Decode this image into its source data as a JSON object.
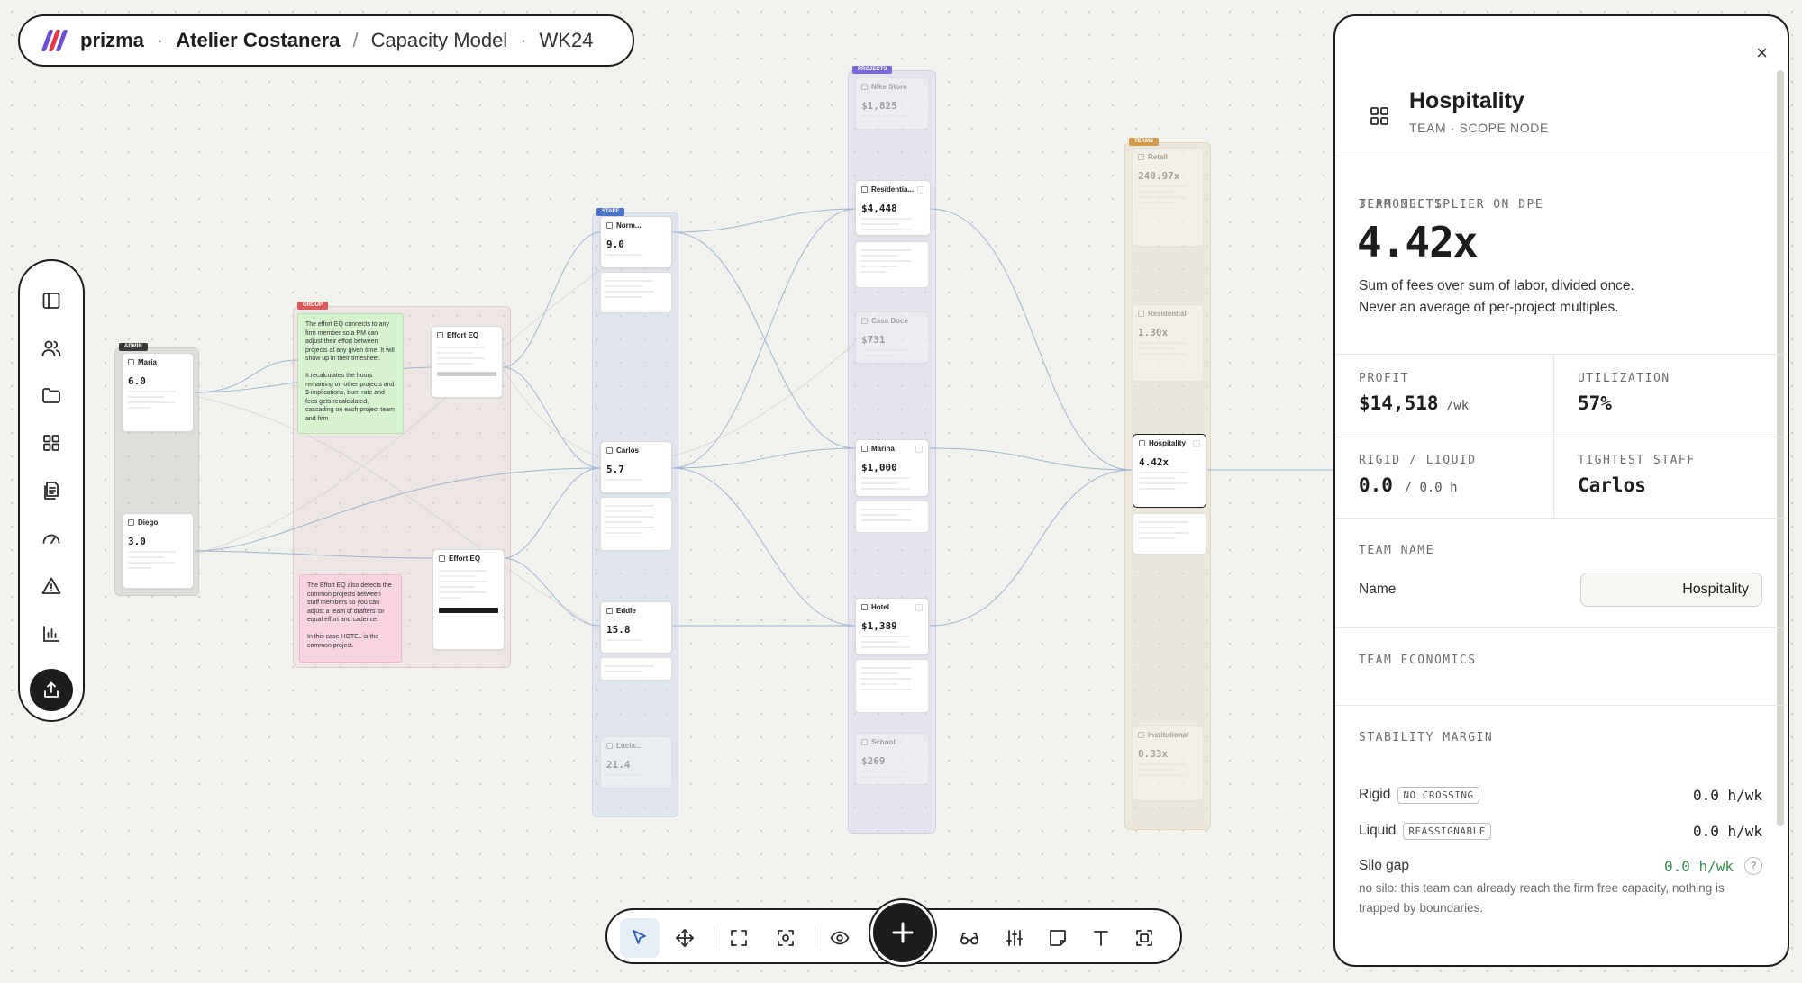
{
  "header": {
    "brand": "prizma",
    "separator_dot": "·",
    "organization": "Atelier Costanera",
    "separator_slash": "/",
    "model": "Capacity Model",
    "week": "WK24",
    "logo_colors": [
      "#6a4fd0",
      "#e6394a",
      "#6a4fd0"
    ]
  },
  "rail": {
    "items": [
      "sidebar-icon",
      "people-icon",
      "folder-icon",
      "grid-icon",
      "report-icon",
      "gauge-icon",
      "alert-icon",
      "bar-chart-icon"
    ],
    "export": "export-icon"
  },
  "canvas": {
    "lanes": {
      "admin": "ADMIN",
      "group": "GROUP",
      "staff": "STAFF",
      "projects": "PROJECTS",
      "teams": "TEAMS"
    },
    "lane_colors": {
      "admin": "#3a3a38",
      "group": "#d85a58",
      "staff": "#4a74c9",
      "projects": "#7c6ad6",
      "teams": "#d59a4a"
    },
    "admin": [
      {
        "name": "Maria",
        "value": "6.0"
      },
      {
        "name": "Diego",
        "value": "3.0"
      }
    ],
    "effort_eq_top": {
      "title": "Effort EQ"
    },
    "effort_eq_bottom": {
      "title": "Effort EQ"
    },
    "note_green": "The effort EQ connects to any firm member so a PM can adjust their effort between projects at any given time. It will show up in their timesheet.\n\nIt recalculates the hours remaining on other projects and $ implications, burn rate and fees gets recalculated, cascading on each project team and firm",
    "note_pink": "The Effort EQ also detects the common projects between staff members so you can adjust a team of drafters for equal effort and cadence.\n\nIn this case HOTEL is the common project.",
    "staff": [
      {
        "name": "Norm...",
        "value": "9.0"
      },
      {
        "name": "Carlos",
        "value": "5.7"
      },
      {
        "name": "Eddie",
        "value": "15.8"
      },
      {
        "name": "Lucia...",
        "value": "21.4"
      }
    ],
    "projects": [
      {
        "name": "Nike Store",
        "value": "$1,825"
      },
      {
        "name": "Residentia...",
        "value": "$4,448"
      },
      {
        "name": "Casa Doce",
        "value": "$731"
      },
      {
        "name": "Marina",
        "value": "$1,000"
      },
      {
        "name": "Hotel",
        "value": "$1,389"
      },
      {
        "name": "School",
        "value": "$269"
      }
    ],
    "teams": [
      {
        "name": "Retail",
        "value": "240.97x"
      },
      {
        "name": "Residential",
        "value": "1.30x"
      },
      {
        "name": "Hospitality",
        "value": "4.42x"
      },
      {
        "name": "Institutional",
        "value": "0.33x"
      }
    ]
  },
  "toolbar": {
    "tools": [
      "select-icon",
      "move-icon",
      "frame-icon",
      "focus-icon",
      "eye-icon",
      "glasses-icon",
      "sliders-icon",
      "sticky-note-icon",
      "text-icon",
      "screenshot-icon"
    ],
    "add": "plus-icon"
  },
  "panel": {
    "close": "×",
    "title": "Hospitality",
    "subtitle": "TEAM · SCOPE NODE",
    "multiplier_label": "TEAM MULTIPLIER ON DPE",
    "project_count": "3 PROJECTS",
    "multiplier_value": "4.42x",
    "multiplier_desc_1": "Sum of fees over sum of labor, divided once.",
    "multiplier_desc_2": "Never an average of per-project multiples.",
    "profit_label": "PROFIT",
    "profit_value": "$14,518",
    "profit_unit": " /wk",
    "utilization_label": "UTILIZATION",
    "utilization_value": "57%",
    "rigid_liquid_label": "RIGID / LIQUID",
    "rigid_value": "0.0",
    "liquid_value": "/ 0.0 h",
    "tightest_label": "TIGHTEST STAFF",
    "tightest_value": "Carlos",
    "team_name_label": "TEAM NAME",
    "name_field_label": "Name",
    "name_field_value": "Hospitality",
    "economics_label": "TEAM ECONOMICS",
    "stability_label": "STABILITY MARGIN",
    "rigid_row": {
      "label": "Rigid",
      "pill": "NO CROSSING",
      "value": "0.0 h/wk"
    },
    "liquid_row": {
      "label": "Liquid",
      "pill": "REASSIGNABLE",
      "value": "0.0 h/wk"
    },
    "silo_row": {
      "label": "Silo gap",
      "value": "0.0 h/wk",
      "help": "?"
    },
    "footnote": "no silo: this team can already reach the firm free capacity, nothing is trapped by boundaries."
  }
}
